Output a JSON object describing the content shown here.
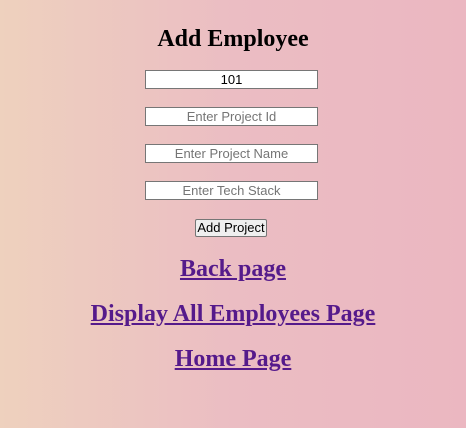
{
  "page": {
    "title": "Add Employee"
  },
  "form": {
    "field1": {
      "value": "101",
      "placeholder": ""
    },
    "project_id": {
      "value": "",
      "placeholder": "Enter Project Id"
    },
    "project_name": {
      "value": "",
      "placeholder": "Enter Project Name"
    },
    "tech_stack": {
      "value": "",
      "placeholder": "Enter Tech Stack"
    },
    "submit_label": "Add Project"
  },
  "links": {
    "back": "Back page",
    "display_all": "Display All Employees Page",
    "home": "Home Page"
  },
  "colors": {
    "link": "#551a8b",
    "background_left": "#eed1be",
    "background_right": "#ebb7c1"
  }
}
